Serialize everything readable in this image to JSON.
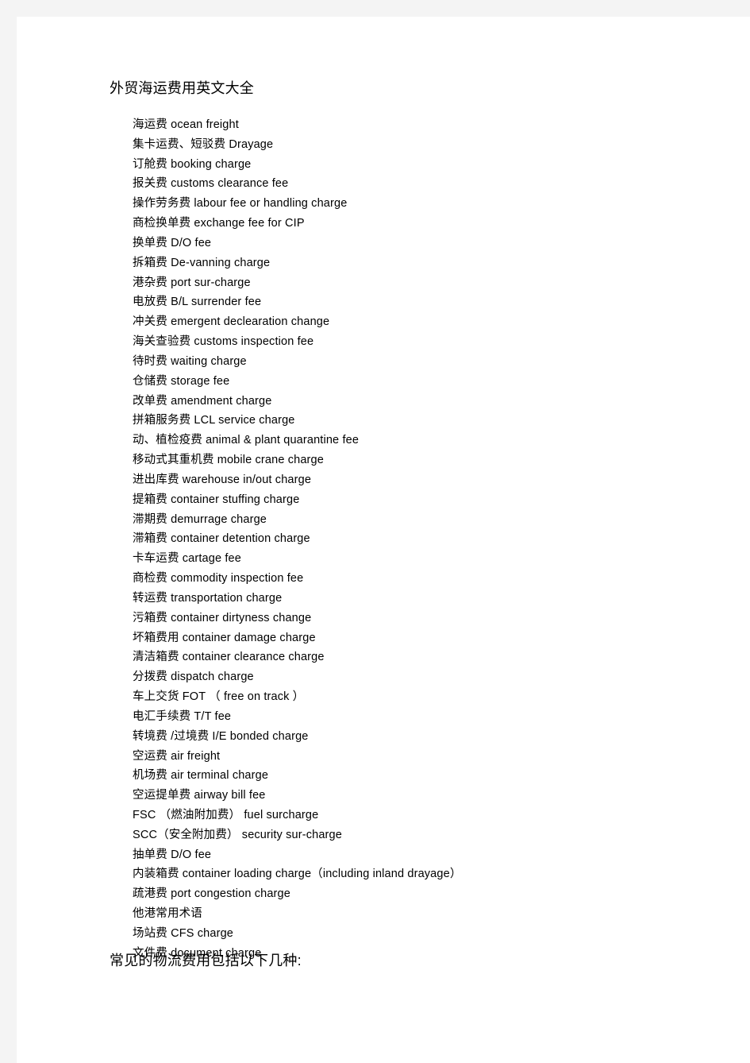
{
  "document": {
    "title": "外贸海运费用英文大全",
    "closing_heading": "常见的物流费用包括以下几种:",
    "page_background": "#ffffff",
    "canvas_background": "#f4f4f4",
    "text_color": "#000000"
  },
  "fee_list": [
    {
      "cn": "海运费",
      "en": "ocean freight",
      "line": "海运费  ocean freight"
    },
    {
      "cn": "集卡运费、短驳费",
      "en": "Drayage",
      "line": "集卡运费、短驳费   Drayage"
    },
    {
      "cn": "订舱费",
      "en": "booking charge",
      "line": "订舱费  booking charge"
    },
    {
      "cn": "报关费",
      "en": "customs clearance fee",
      "line": "报关费  customs clearance fee"
    },
    {
      "cn": "操作劳务费",
      "en": "labour fee or handling charge",
      "line": "操作劳务费   labour fee or handling charge"
    },
    {
      "cn": "商检换单费",
      "en": "exchange fee for CIP",
      "line": "商检换单费   exchange fee for CIP"
    },
    {
      "cn": "换单费",
      "en": "D/O fee",
      "line": "换单费  D/O fee"
    },
    {
      "cn": "拆箱费",
      "en": "De-vanning charge",
      "line": "拆箱费  De-vanning charge"
    },
    {
      "cn": "港杂费",
      "en": "port sur-charge",
      "line": "港杂费  port sur-charge"
    },
    {
      "cn": "电放费",
      "en": "B/L surrender fee",
      "line": "电放费  B/L surrender fee"
    },
    {
      "cn": "冲关费",
      "en": "emergent declearation change",
      "line": "冲关费  emergent declearation change"
    },
    {
      "cn": "海关查验费",
      "en": "customs inspection fee",
      "line": "海关查验费   customs inspection fee"
    },
    {
      "cn": "待时费",
      "en": "waiting charge",
      "line": "待时费  waiting charge"
    },
    {
      "cn": "仓储费",
      "en": "storage fee",
      "line": "仓储费  storage fee"
    },
    {
      "cn": "改单费",
      "en": "amendment charge",
      "line": "改单费  amendment charge"
    },
    {
      "cn": "拼箱服务费",
      "en": "LCL service charge",
      "line": "拼箱服务费   LCL service charge"
    },
    {
      "cn": "动、植检疫费",
      "en": "animal & plant quarantine fee",
      "line": "动、植检疫费   animal & plant quarantine fee"
    },
    {
      "cn": "移动式其重机费",
      "en": "mobile crane charge",
      "line": "移动式其重机费   mobile crane charge"
    },
    {
      "cn": "进出库费",
      "en": "warehouse in/out charge",
      "line": "进出库费  warehouse in/out charge"
    },
    {
      "cn": "提箱费",
      "en": "container stuffing charge",
      "line": "提箱费  container stuffing charge"
    },
    {
      "cn": "滞期费",
      "en": "demurrage charge",
      "line": "滞期费  demurrage charge"
    },
    {
      "cn": "滞箱费",
      "en": "container detention charge",
      "line": "滞箱费  container detention charge"
    },
    {
      "cn": "卡车运费",
      "en": "cartage fee",
      "line": "卡车运费  cartage fee"
    },
    {
      "cn": "商检费",
      "en": "commodity inspection fee",
      "line": "商检费  commodity inspection fee"
    },
    {
      "cn": "转运费",
      "en": "transportation charge",
      "line": "转运费  transportation charge"
    },
    {
      "cn": "污箱费",
      "en": "container dirtyness change",
      "line": "污箱费  container dirtyness change"
    },
    {
      "cn": "坏箱费用",
      "en": "container damage charge",
      "line": "坏箱费用   container damage charge"
    },
    {
      "cn": "清洁箱费",
      "en": "container clearance charge",
      "line": "清洁箱费   container clearance charge"
    },
    {
      "cn": "分拨费",
      "en": "dispatch charge",
      "line": "分拨费  dispatch charge"
    },
    {
      "cn": "车上交货",
      "en": "FOT （free on track）",
      "line": "车上交货  FOT  （ free on track ）"
    },
    {
      "cn": "电汇手续费",
      "en": "T/T fee",
      "line": "电汇手续费   T/T fee"
    },
    {
      "cn": "转境费/过境费",
      "en": "I/E bonded charge",
      "line": "转境费 /过境费  I/E bonded charge"
    },
    {
      "cn": "空运费",
      "en": "air freight",
      "line": "空运费  air freight"
    },
    {
      "cn": "机场费",
      "en": "air terminal charge",
      "line": "机场费  air terminal charge"
    },
    {
      "cn": "空运提单费",
      "en": "airway bill fee",
      "line": "空运提单费   airway bill fee"
    },
    {
      "cn": "FSC（燃油附加费）",
      "en": "fuel surcharge",
      "line": "FSC  （燃油附加费）   fuel surcharge"
    },
    {
      "cn": "SCC（安全附加费）",
      "en": "security sur-charge",
      "line": "SCC（安全附加费）   security sur-charge"
    },
    {
      "cn": "抽单费",
      "en": "D/O fee",
      "line": "抽单费  D/O fee"
    },
    {
      "cn": "内装箱费",
      "en": "container loading charge（including inland drayage）",
      "line": "内装箱费  container loading charge（including inland drayage）"
    },
    {
      "cn": "疏港费",
      "en": "port congestion charge",
      "line": "疏港费  port congestion charge"
    },
    {
      "cn": "他港常用术语",
      "en": "",
      "line": "他港常用术语"
    },
    {
      "cn": "场站费",
      "en": "CFS charge",
      "line": "场站费  CFS charge"
    },
    {
      "cn": "文件费",
      "en": "document charge",
      "line": "文件费  document charge"
    }
  ]
}
